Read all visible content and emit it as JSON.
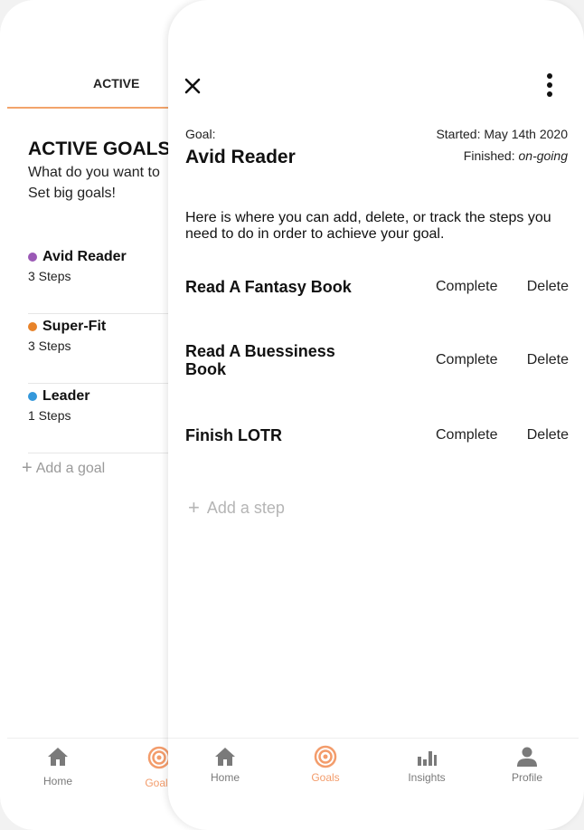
{
  "background_screen": {
    "tab_active_label": "ACTIVE",
    "heading": "ACTIVE GOALS",
    "subtitle_line1": "What do you want to",
    "subtitle_line2": "Set big goals!",
    "goals": [
      {
        "name": "Avid Reader",
        "steps": "3 Steps",
        "color": "#9b59b6"
      },
      {
        "name": "Super-Fit",
        "steps": "3 Steps",
        "color": "#e8832a"
      },
      {
        "name": "Leader",
        "steps": "1 Steps",
        "color": "#3498db"
      }
    ],
    "add_goal_label": "Add a goal",
    "nav": {
      "home_label": "Home",
      "goals_label": "Goals"
    }
  },
  "detail": {
    "goal_label": "Goal:",
    "goal_name": "Avid Reader",
    "started": "Started: May 14th 2020",
    "finished_label": "Finished: ",
    "finished_value": "on-going",
    "description": "Here is where you can add, delete, or track the steps you need to do in order to achieve your goal.",
    "steps": [
      {
        "name": "Read A Fantasy Book",
        "complete_label": "Complete",
        "delete_label": "Delete"
      },
      {
        "name": "Read A Buessiness Book",
        "complete_label": "Complete",
        "delete_label": "Delete"
      },
      {
        "name": "Finish LOTR",
        "complete_label": "Complete",
        "delete_label": "Delete"
      }
    ],
    "add_step_label": "Add a step"
  },
  "bottom_nav": {
    "items": [
      {
        "label": "Home",
        "icon": "home-icon"
      },
      {
        "label": "Goals",
        "icon": "target-icon"
      },
      {
        "label": "Insights",
        "icon": "bar-chart-icon"
      },
      {
        "label": "Profile",
        "icon": "person-icon"
      }
    ],
    "active_index": 1
  },
  "colors": {
    "accent": "#f2a46b",
    "goals_icon": "#f39c6b",
    "nav_inactive": "#7a7a7a",
    "placeholder": "#b5b5b5"
  }
}
